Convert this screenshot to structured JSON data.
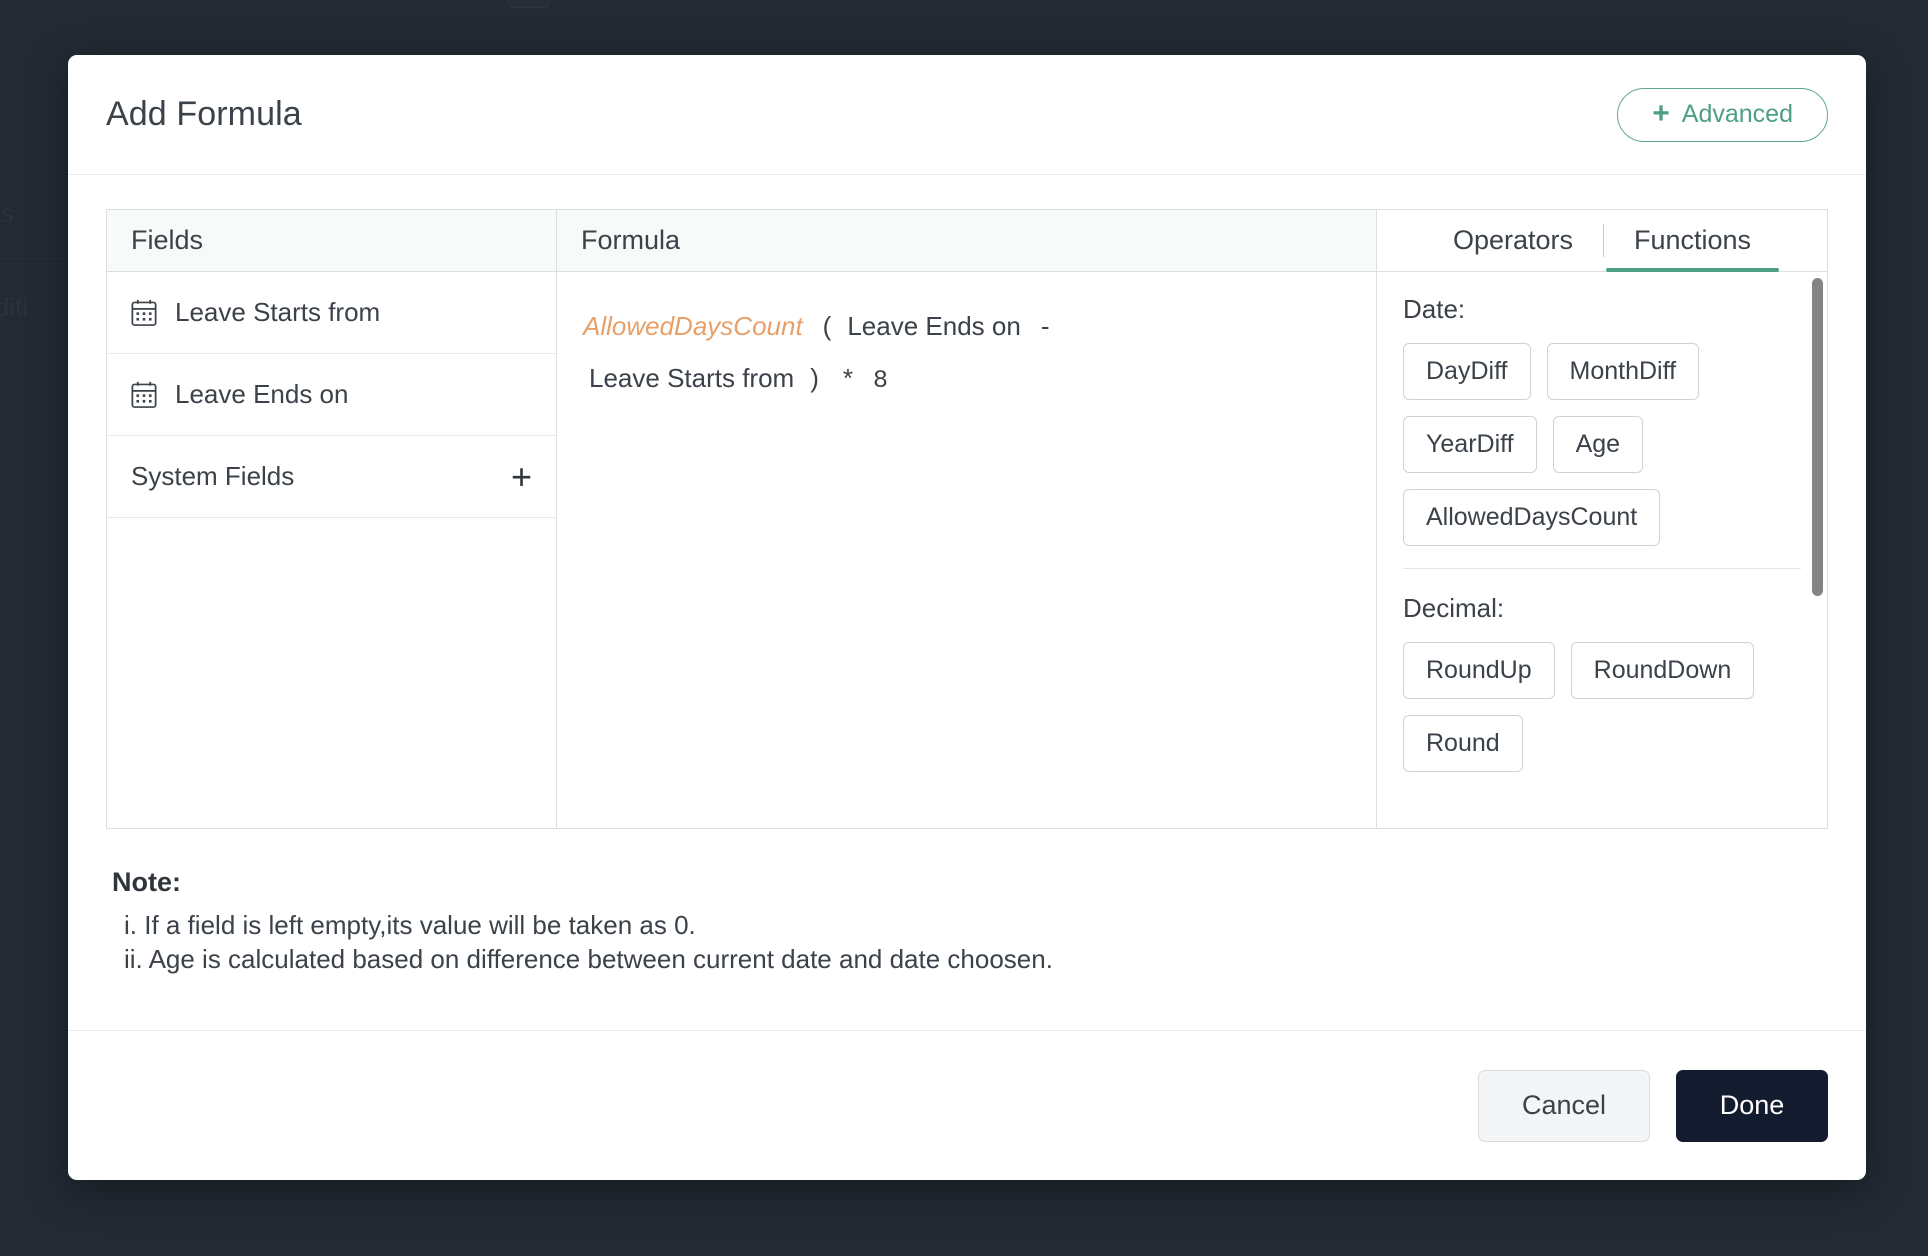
{
  "background": {
    "text_fragment_1": "es",
    "text_fragment_2": "onditi"
  },
  "modal": {
    "title": "Add Formula",
    "advanced_button": {
      "label": "Advanced",
      "icon": "plus-icon",
      "plus_glyph": "+",
      "color": "#4f9f83"
    }
  },
  "fields_panel": {
    "header": "Fields",
    "items": [
      {
        "label": "Leave Starts from",
        "icon": "calendar-icon"
      },
      {
        "label": "Leave Ends on",
        "icon": "calendar-icon"
      }
    ],
    "system_fields": {
      "label": "System Fields",
      "add_glyph": "+"
    }
  },
  "formula_panel": {
    "header": "Formula",
    "expression_text": "AllowedDaysCount ( Leave Ends on - Leave Starts from ) * 8",
    "tokens": {
      "function": "AllowedDaysCount",
      "open_paren": "(",
      "field_1": "Leave Ends on",
      "operator_minus": "-",
      "field_2": "Leave Starts from",
      "close_paren": ")",
      "operator_multiply": "*",
      "number": "8"
    },
    "function_token_color": "#e8a06b"
  },
  "functions_panel": {
    "tabs": [
      {
        "label": "Operators",
        "active": false
      },
      {
        "label": "Functions",
        "active": true
      }
    ],
    "active_tab_color": "#4f9f83",
    "groups": [
      {
        "label": "Date:",
        "rows": [
          [
            "DayDiff",
            "MonthDiff"
          ],
          [
            "YearDiff",
            "Age"
          ],
          [
            "AllowedDaysCount"
          ]
        ]
      },
      {
        "label": "Decimal:",
        "rows": [
          [
            "RoundUp",
            "RoundDown"
          ],
          [
            "Round"
          ]
        ]
      }
    ]
  },
  "note": {
    "title": "Note:",
    "lines": [
      "i. If a field is left empty,its value will be taken as 0.",
      "ii. Age is calculated based on difference between current date and date choosen."
    ]
  },
  "footer": {
    "cancel_label": "Cancel",
    "done_label": "Done",
    "done_bg": "#131c2e"
  }
}
